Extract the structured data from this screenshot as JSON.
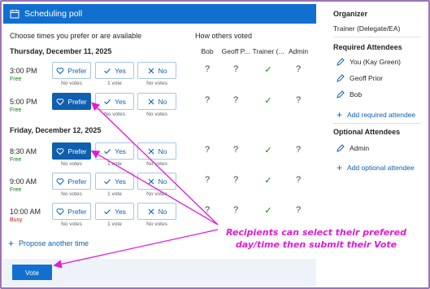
{
  "header": {
    "title": "Scheduling poll",
    "icon": "calendar-poll-icon"
  },
  "left": {
    "choose_label": "Choose times you prefer or are available",
    "others_label": "How others voted",
    "columns": [
      "Bob",
      "Geoff P...",
      "Trainer (...",
      "Admin"
    ],
    "days": [
      {
        "title": "Thursday, December 11, 2025",
        "slots": [
          {
            "time": "3:00 PM",
            "status": "Free",
            "selected": "none",
            "prefer": "Prefer",
            "yes": "Yes",
            "no": "No",
            "prefer_votes": "No votes",
            "yes_votes": "1 vote",
            "no_votes": "No votes",
            "others": [
              "?",
              "?",
              "✓",
              "?"
            ]
          },
          {
            "time": "5:00 PM",
            "status": "Free",
            "selected": "prefer",
            "prefer": "Prefer",
            "yes": "Yes",
            "no": "No",
            "prefer_votes": "",
            "yes_votes": "No votes",
            "no_votes": "No votes",
            "others": [
              "?",
              "?",
              "✓",
              "?"
            ]
          }
        ]
      },
      {
        "title": "Friday, December 12, 2025",
        "slots": [
          {
            "time": "8:30 AM",
            "status": "Free",
            "selected": "prefer",
            "prefer": "Prefer",
            "yes": "Yes",
            "no": "No",
            "prefer_votes": "No votes",
            "yes_votes": "1 vote",
            "no_votes": "No votes",
            "others": [
              "?",
              "?",
              "✓",
              "?"
            ]
          },
          {
            "time": "9:00 AM",
            "status": "Free",
            "selected": "none",
            "prefer": "Prefer",
            "yes": "Yes",
            "no": "No",
            "prefer_votes": "No votes",
            "yes_votes": "1 vote",
            "no_votes": "No votes",
            "others": [
              "?",
              "?",
              "✓",
              "?"
            ]
          },
          {
            "time": "10:00 AM",
            "status": "Busy",
            "selected": "none",
            "prefer": "Prefer",
            "yes": "Yes",
            "no": "No",
            "prefer_votes": "No votes",
            "yes_votes": "1 vote",
            "no_votes": "No votes",
            "others": [
              "?",
              "?",
              "✓",
              "?"
            ]
          }
        ]
      }
    ],
    "propose_label": "Propose another time",
    "vote_button": "Vote"
  },
  "right": {
    "organizer_title": "Organizer",
    "organizer_name": "Trainer (Delegate/EA)",
    "required_title": "Required Attendees",
    "required": [
      "You (Kay Green)",
      "Geoff Prior",
      "Bob"
    ],
    "add_required": "Add required attendee",
    "optional_title": "Optional Attendees",
    "optional": [
      "Admin"
    ],
    "add_optional": "Add optional attendee"
  },
  "annotation": {
    "line1": "Recipients can select their prefered",
    "line2": "day/time then submit their Vote",
    "color": "#e11ad6"
  },
  "colors": {
    "accent": "#1170cf",
    "free": "#107c10",
    "busy": "#c50f1f"
  }
}
